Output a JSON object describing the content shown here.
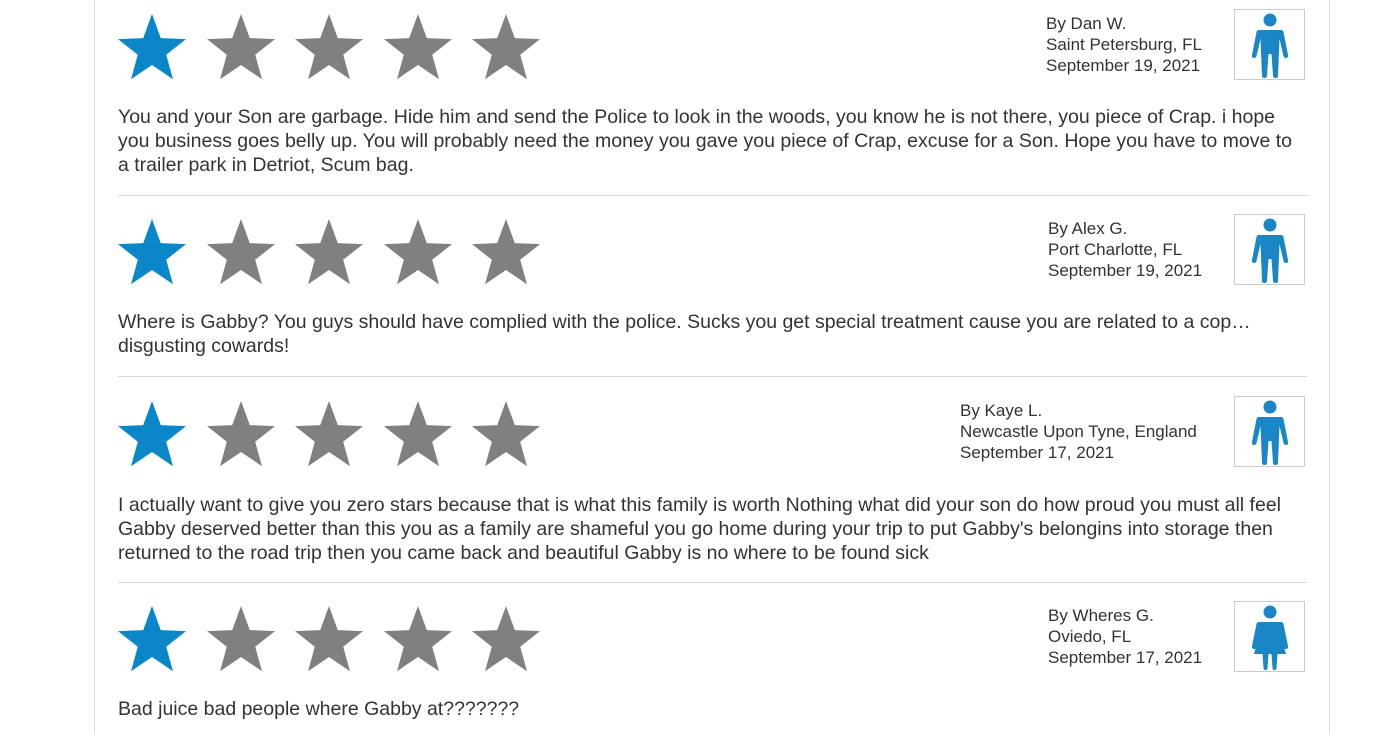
{
  "colors": {
    "star_filled": "#0a87c9",
    "star_empty": "#808080",
    "avatar_icon": "#1a86c5",
    "text": "#333333",
    "divider": "#d6d6d6"
  },
  "reviews": [
    {
      "rating": 1,
      "max_rating": 5,
      "author": "By Dan W.",
      "location": "Saint Petersburg, FL",
      "date": "September 19, 2021",
      "avatar_icon": "male-user-icon",
      "text": "You and your Son are garbage. Hide him and send the Police to look in the woods, you know he is not there, you piece of Crap. i hope you business goes belly up. You will probably need the money you gave you piece of Crap, excuse for a Son. Hope you have to move to a trailer park in Detriot, Scum bag."
    },
    {
      "rating": 1,
      "max_rating": 5,
      "author": "By Alex G.",
      "location": "Port Charlotte, FL",
      "date": "September 19, 2021",
      "avatar_icon": "male-user-icon",
      "text": "Where is Gabby? You guys should have complied with the police. Sucks you get special treatment cause you are related to a cop…disgusting cowards!"
    },
    {
      "rating": 1,
      "max_rating": 5,
      "author": "By Kaye L.",
      "location": "Newcastle Upon Tyne, England",
      "date": "September 17, 2021",
      "avatar_icon": "male-user-icon",
      "text": "I actually want to give you zero stars because that is what this family is worth Nothing what did your son do how proud you must all feel Gabby deserved better than this you as a family are shameful you go home during your trip to put Gabby's belongins into storage then returned to the road trip then you came back and beautiful Gabby is no where to be found sick"
    },
    {
      "rating": 1,
      "max_rating": 5,
      "author": "By Wheres G.",
      "location": "Oviedo, FL",
      "date": "September 17, 2021",
      "avatar_icon": "female-user-icon",
      "text": "Bad juice bad people where Gabby at???????"
    }
  ]
}
